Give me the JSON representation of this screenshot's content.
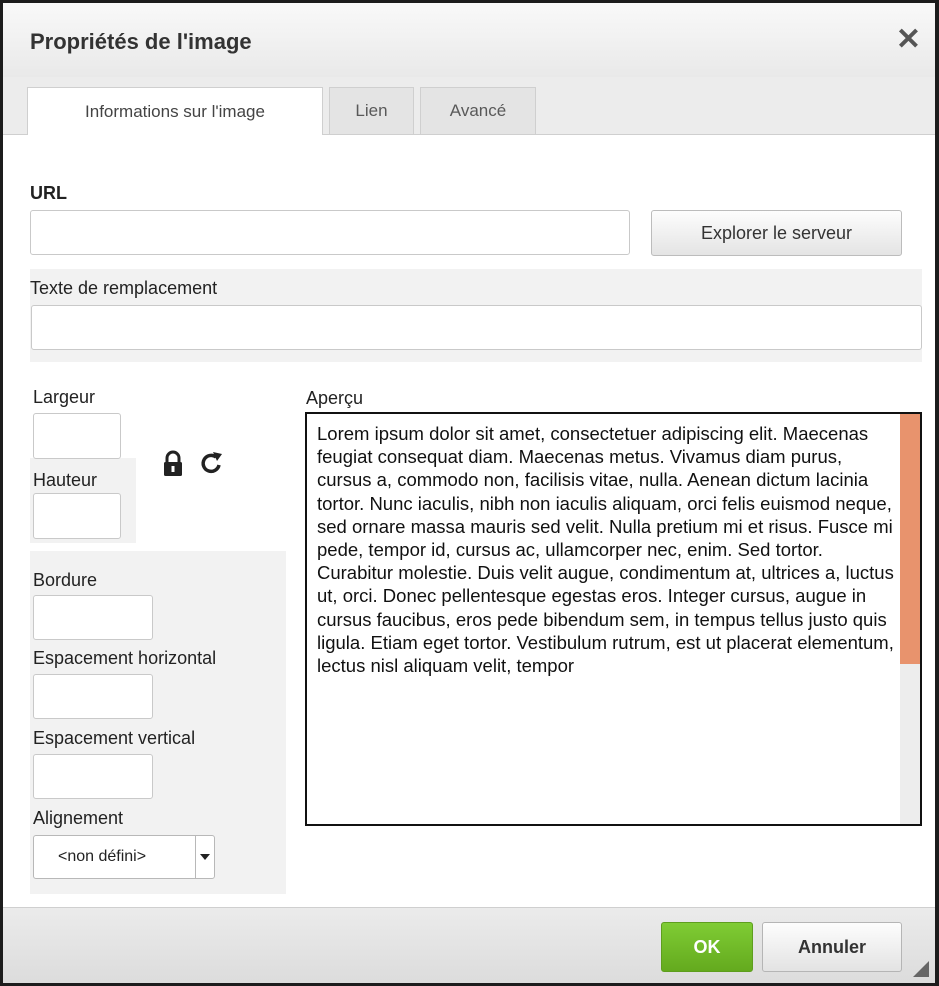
{
  "dialog": {
    "title": "Propriétés de l'image",
    "close_symbol": "✕"
  },
  "tabs": [
    {
      "label": "Informations sur l'image",
      "active": true
    },
    {
      "label": "Lien",
      "active": false
    },
    {
      "label": "Avancé",
      "active": false
    }
  ],
  "form": {
    "url_label": "URL",
    "url_value": "",
    "browse_button": "Explorer le serveur",
    "alt_label": "Texte de remplacement",
    "alt_value": "",
    "width_label": "Largeur",
    "width_value": "",
    "height_label": "Hauteur",
    "height_value": "",
    "border_label": "Bordure",
    "border_value": "",
    "hspace_label": "Espacement horizontal",
    "hspace_value": "",
    "vspace_label": "Espacement vertical",
    "vspace_value": "",
    "align_label": "Alignement",
    "align_selected": "<non défini>",
    "lock_icon": "lock-icon",
    "reset_icon": "refresh-icon"
  },
  "preview": {
    "label": "Aperçu",
    "text": "Lorem ipsum dolor sit amet, consectetuer adipiscing elit. Maecenas feugiat consequat diam. Maecenas metus. Vivamus diam purus, cursus a, commodo non, facilisis vitae, nulla. Aenean dictum lacinia tortor. Nunc iaculis, nibh non iaculis aliquam, orci felis euismod neque, sed ornare massa mauris sed velit. Nulla pretium mi et risus. Fusce mi pede, tempor id, cursus ac, ullamcorper nec, enim. Sed tortor. Curabitur molestie. Duis velit augue, condimentum at, ultrices a, luctus ut, orci. Donec pellentesque egestas eros. Integer cursus, augue in cursus faucibus, eros pede bibendum sem, in tempus tellus justo quis ligula. Etiam eget tortor. Vestibulum rutrum, est ut placerat elementum, lectus nisl aliquam velit, tempor"
  },
  "footer": {
    "ok_button": "OK",
    "cancel_button": "Annuler"
  },
  "colors": {
    "ok_green": "#6cb824",
    "scroll_thumb": "#e8936d"
  }
}
